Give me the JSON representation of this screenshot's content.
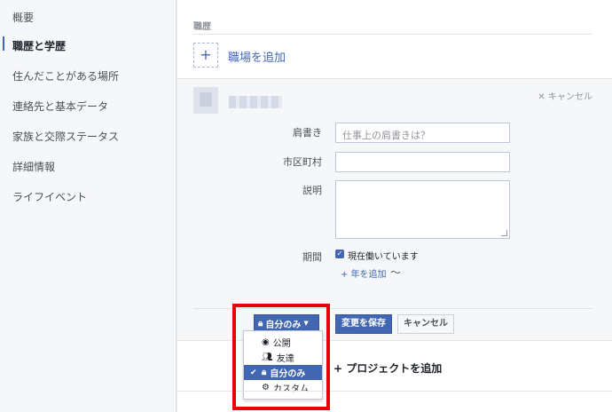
{
  "sidebar": {
    "items": [
      {
        "label": "概要"
      },
      {
        "label": "職歴と学歴"
      },
      {
        "label": "住んだことがある場所"
      },
      {
        "label": "連絡先と基本データ"
      },
      {
        "label": "家族と交際ステータス"
      },
      {
        "label": "詳細情報"
      },
      {
        "label": "ライフイベント"
      }
    ]
  },
  "work": {
    "section_title": "職歴",
    "add_plus": "+",
    "add_label": "職場を追加",
    "cancel_label": "キャンセル",
    "cancel_icon": "x-icon"
  },
  "form": {
    "position_label": "肩書き",
    "position_placeholder": "仕事上の肩書きは？",
    "city_label": "市区町村",
    "description_label": "説明",
    "period_label": "期間",
    "current_label": "現在働いています",
    "add_year_label": "+ 年を追加",
    "tilde": "〜"
  },
  "actions": {
    "privacy_label": "自分のみ",
    "save_label": "変更を保存",
    "cancel_label": "キャンセル"
  },
  "privacy_menu": {
    "options": [
      {
        "label": "公開",
        "icon": "globe-icon",
        "selected": false
      },
      {
        "label": "友達",
        "icon": "friends-icon",
        "selected": false
      },
      {
        "label": "自分のみ",
        "icon": "lock-icon",
        "selected": true
      },
      {
        "label": "カスタム",
        "icon": "gear-icon",
        "selected": false
      }
    ]
  },
  "project": {
    "add_label": "+ プロジェクトを追加"
  },
  "colors": {
    "accent": "#4267b2",
    "highlight": "#e8000b"
  }
}
